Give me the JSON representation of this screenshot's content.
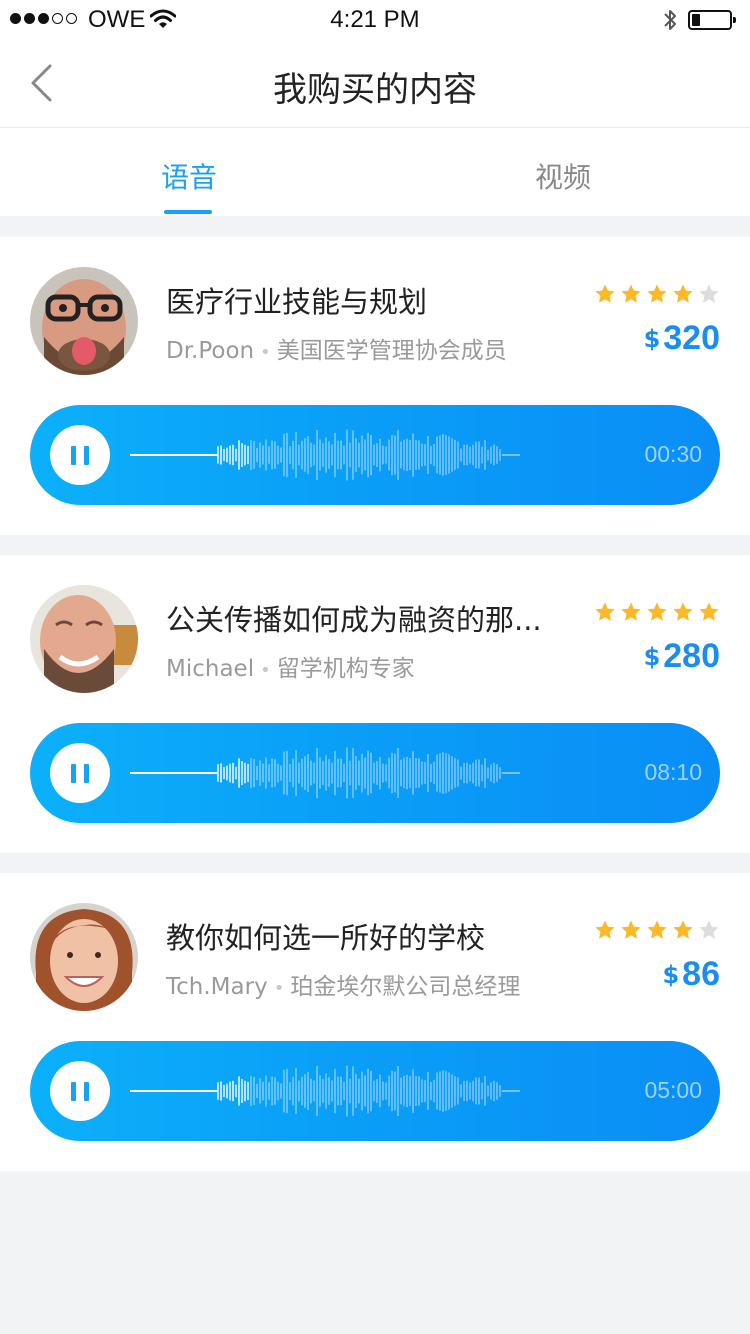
{
  "status_bar": {
    "carrier": "OWE",
    "time": "4:21 PM",
    "signal_icon": "signal-dots-icon",
    "wifi_icon": "wifi-icon",
    "bluetooth_icon": "bluetooth-icon",
    "battery_icon": "battery-icon"
  },
  "nav": {
    "title": "我购买的内容",
    "back_icon": "chevron-left-icon"
  },
  "tabs": [
    {
      "label": "语音",
      "active": true
    },
    {
      "label": "视频",
      "active": false
    }
  ],
  "colors": {
    "accent": "#1aa0f5",
    "star_on": "#fbb928",
    "star_off": "#dddddd",
    "price": "#1a8ef0"
  },
  "courses": [
    {
      "title": "医疗行业技能与规划",
      "author": "Dr.Poon",
      "role": "美国医学管理协会成员",
      "rating": 4,
      "currency": "$",
      "price": "320",
      "duration": "00:30",
      "play_icon": "pause-icon"
    },
    {
      "title": "公关传播如何成为融资的那...",
      "author": "Michael",
      "role": "留学机构专家",
      "rating": 5,
      "currency": "$",
      "price": "280",
      "duration": "08:10",
      "play_icon": "pause-icon"
    },
    {
      "title": "教你如何选一所好的学校",
      "author": "Tch.Mary",
      "role": "珀金埃尔默公司总经理",
      "rating": 4,
      "currency": "$",
      "price": "86",
      "duration": "05:00",
      "play_icon": "pause-icon"
    }
  ]
}
